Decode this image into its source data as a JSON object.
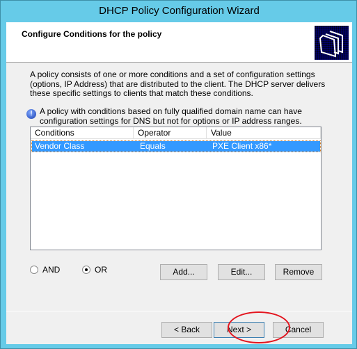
{
  "window": {
    "title": "DHCP Policy Configuration Wizard"
  },
  "header": {
    "title": "Configure Conditions for the policy",
    "icon": "folders-icon"
  },
  "description": "A policy consists of one or more conditions and a set of configuration settings (options, IP Address) that are distributed to the client. The DHCP server delivers these specific settings to clients that match these conditions.",
  "info": {
    "icon": "info-icon",
    "text": "A policy with conditions based on fully qualified domain name can have configuration settings for DNS but not for options or IP address ranges."
  },
  "list": {
    "columns": [
      "Conditions",
      "Operator",
      "Value"
    ],
    "rows": [
      {
        "condition": "Vendor Class",
        "operator": "Equals",
        "value": "PXE Client x86*",
        "selected": true
      }
    ]
  },
  "logic": {
    "and_label": "AND",
    "or_label": "OR",
    "selected": "OR"
  },
  "buttons": {
    "add": "Add...",
    "edit": "Edit...",
    "remove": "Remove",
    "back": "< Back",
    "next": "Next >",
    "cancel": "Cancel"
  },
  "annotation": {
    "color": "#e3141e",
    "target": "next"
  }
}
